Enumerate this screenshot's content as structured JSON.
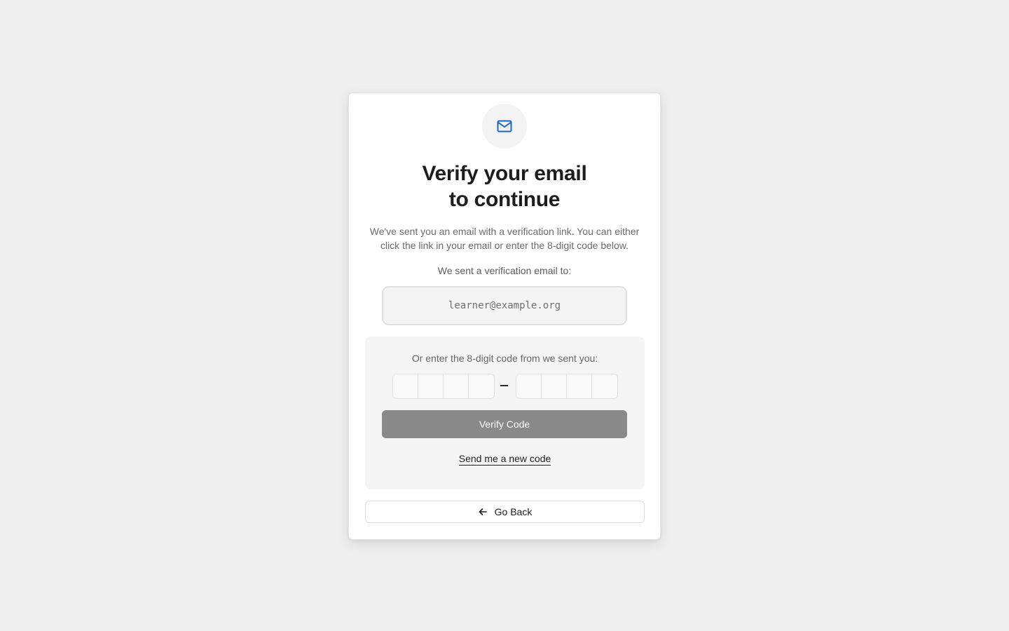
{
  "icon": "mail-icon",
  "accent_color": "#1d63c4",
  "title_line1": "Verify your email",
  "title_line2": "to continue",
  "description": "We've sent you an email with a verification link. You can either click the link in your email or enter the 8-digit code below.",
  "sent_label": "We sent a verification email to:",
  "email": "learner@example.org",
  "code": {
    "label": "Or enter the 8-digit code from we sent you:",
    "digits": [
      "",
      "",
      "",
      "",
      "",
      "",
      "",
      ""
    ]
  },
  "verify_button_label": "Verify Code",
  "resend_link_label": "Send me a new code",
  "back_button": {
    "icon": "arrow-left-icon",
    "label": "Go Back"
  }
}
